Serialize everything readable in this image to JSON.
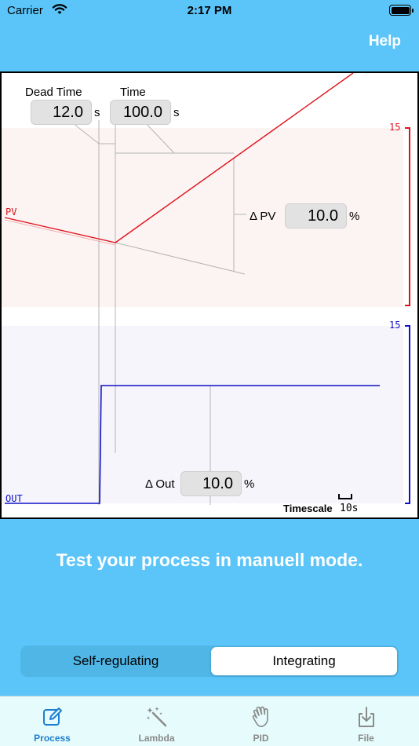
{
  "status_bar": {
    "carrier": "Carrier",
    "time": "2:17 PM"
  },
  "header": {
    "help_label": "Help"
  },
  "chart": {
    "dead_time": {
      "label": "Dead Time",
      "value": "12.0",
      "unit": "s"
    },
    "time": {
      "label": "Time",
      "value": "100.0",
      "unit": "s"
    },
    "delta_pv": {
      "label": "Δ PV",
      "value": "10.0",
      "unit": "%"
    },
    "delta_out": {
      "label": "Δ Out",
      "value": "10.0",
      "unit": "%"
    },
    "pv_tag": "PV",
    "out_tag": "OUT",
    "pv_scale_max": "15",
    "out_scale_max": "15",
    "timescale_label": "Timescale",
    "timescale_value": "10s",
    "colors": {
      "pv": "#e0101a",
      "out": "#1010c8",
      "pv_band": "#fbf4f3",
      "out_band": "#f5f5fb",
      "guide": "#b4b4b4"
    }
  },
  "hint": "Test your process in manuell mode.",
  "segmented": {
    "options": [
      "Self-regulating",
      "Integrating"
    ],
    "selected": "Integrating"
  },
  "tabs": [
    {
      "label": "Process",
      "icon": "edit-square-icon",
      "active": true
    },
    {
      "label": "Lambda",
      "icon": "magic-wand-icon",
      "active": false
    },
    {
      "label": "PID",
      "icon": "hand-wave-icon",
      "active": false
    },
    {
      "label": "File",
      "icon": "download-tray-icon",
      "active": false
    }
  ]
}
